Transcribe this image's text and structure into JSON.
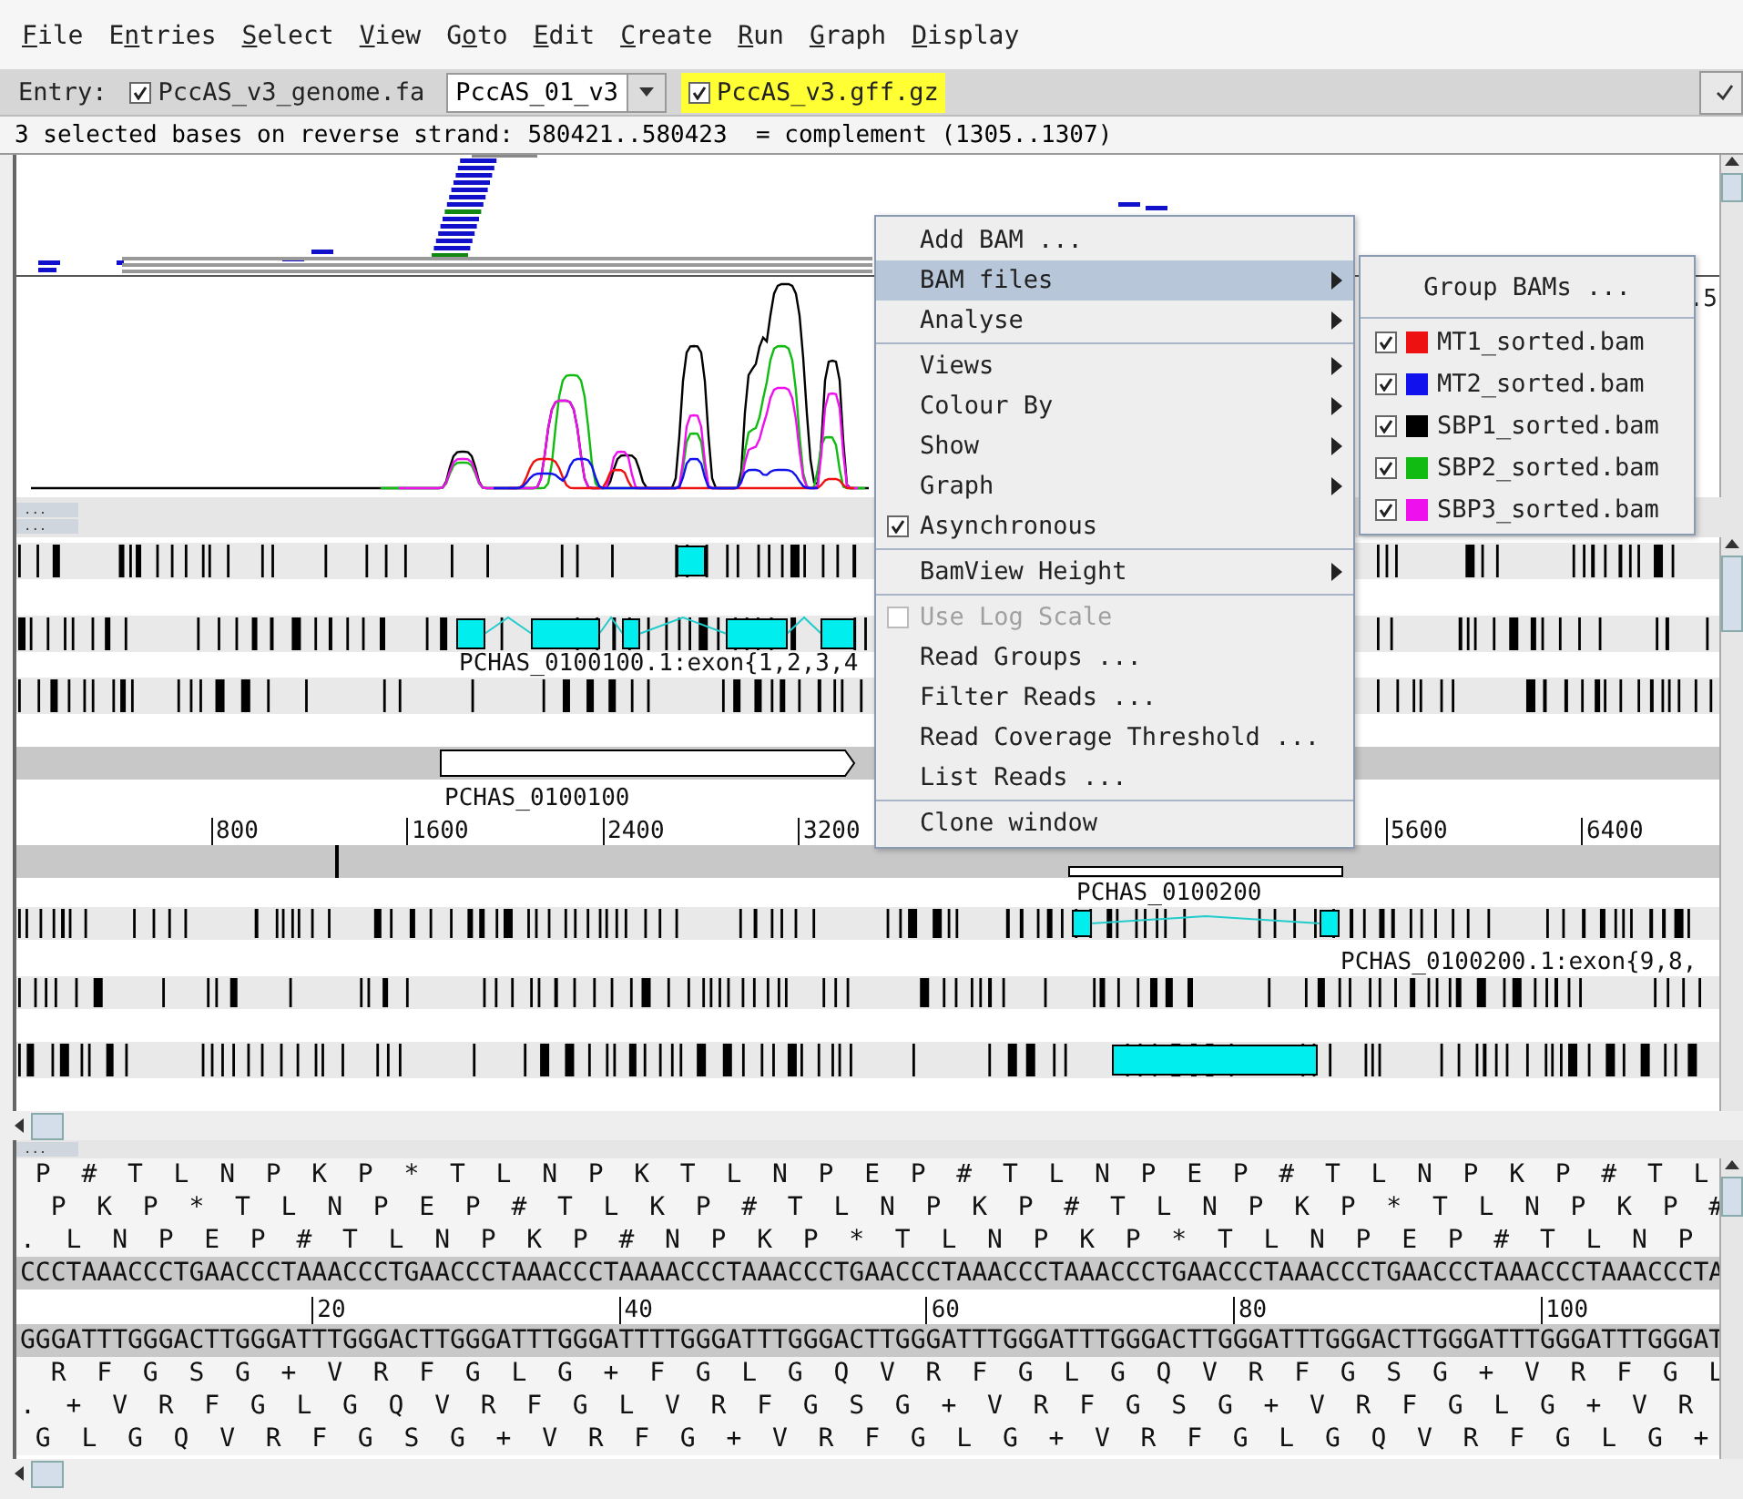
{
  "menu_bar": [
    {
      "underlined": "F",
      "after": "ile"
    },
    {
      "before": "E",
      "underlined": "n",
      "after": "tries"
    },
    {
      "underlined": "S",
      "after": "elect"
    },
    {
      "underlined": "V",
      "after": "iew"
    },
    {
      "before": "G",
      "underlined": "o",
      "after": "to"
    },
    {
      "underlined": "E",
      "after": "dit"
    },
    {
      "underlined": "C",
      "after": "reate"
    },
    {
      "underlined": "R",
      "after": "un"
    },
    {
      "underlined": "G",
      "after": "raph"
    },
    {
      "underlined": "D",
      "after": "isplay"
    }
  ],
  "entry_bar": {
    "label": "Entry:",
    "entries": [
      {
        "name": "PccAS_v3_genome.fa",
        "checked": true,
        "highlighted": false,
        "kind": "sequence"
      },
      {
        "name": "PccAS_v3.gff.gz",
        "checked": true,
        "highlighted": true,
        "kind": "annotation"
      }
    ],
    "combo_value": "PccAS_01_v3"
  },
  "status_line": "3 selected bases on reverse strand: 580421..580423  = complement (1305..1307)",
  "bam_view": {
    "axis_label": ".5"
  },
  "pane_buttons": [
    "...",
    "..."
  ],
  "feature_view": {
    "forward_exon_label": "PCHAS_0100100.1:exon{1,2,3,4",
    "forward_gene_label": "PCHAS_0100100",
    "ruler": [
      "800",
      "1600",
      "2400",
      "3200",
      "5600",
      "6400"
    ],
    "reverse_gene_label": "PCHAS_0100200",
    "reverse_exon_label": "PCHAS_0100200.1:exon{9,8,"
  },
  "sequence_button": "...",
  "sequence_view": {
    "forward_frames": [
      " P  #  T  L  N  P  K  P  *  T  L  N  P  K  T  L  N  P  E  P  #  T  L  N  P  E  P  #  T  L  N  P  K  P  #  T  L",
      "  P  K  P  *  T  L  N  P  E  P  #  T  L  K  P  #  T  L  N  P  K  P  #  T  L  N  P  K  P  *  T  L  N  P  K  P  #",
      ".  L  N  P  E  P  #  T  L  N  P  K  P  #  N  P  K  P  *  T  L  N  P  K  P  *  T  L  N  P  E  P  #  T  L  N  P"
    ],
    "forward_strand": "CCCTAAACCCTGAACCCTAAACCCTGAACCCTAAACCCTAAAACCCTAAACCCTGAACCCTAAACCCTAAACCCTGAACCCTAAACCCTGAACCCTAAACCCTAAACCCTA",
    "ruler": [
      "20",
      "40",
      "60",
      "80",
      "100"
    ],
    "reverse_strand": "GGGATTTGGGACTTGGGATTTGGGACTTGGGATTTGGGATTTTGGGATTTGGGACTTGGGATTTGGGATTTGGGACTTGGGATTTGGGACTTGGGATTTGGGATTTGGGAT",
    "reverse_frames": [
      "  R  F  G  S  G  +  V  R  F  G  L  G  +  F  G  L  G  Q  V  R  F  G  L  G  Q  V  R  F  G  S  G  +  V  R  F  G  L",
      ".  +  V  R  F  G  L  G  Q  V  R  F  G  L  V  R  F  G  S  G  +  V  R  F  G  S  G  +  V  R  F  G  L  G  +  V  R",
      " G  L  G  Q  V  R  F  G  S  G  +  V  R  F  G  +  V  R  F  G  L  G  +  V  R  F  G  L  G  Q  V  R  F  G  L  G  +"
    ]
  },
  "bam_menu": {
    "groups": [
      [
        {
          "label": "Add BAM ...",
          "kind": "action",
          "selected": false,
          "disabled": false
        },
        {
          "label": "BAM files",
          "kind": "submenu",
          "selected": true,
          "disabled": false
        },
        {
          "label": "Analyse",
          "kind": "submenu",
          "selected": false,
          "disabled": false
        }
      ],
      [
        {
          "label": "Views",
          "kind": "submenu",
          "selected": false,
          "disabled": false
        },
        {
          "label": "Colour By",
          "kind": "submenu",
          "selected": false,
          "disabled": false
        },
        {
          "label": "Show",
          "kind": "submenu",
          "selected": false,
          "disabled": false
        },
        {
          "label": "Graph",
          "kind": "submenu",
          "selected": false,
          "disabled": false
        },
        {
          "label": "Asynchronous",
          "kind": "checkbox",
          "checked": true,
          "selected": false,
          "disabled": false
        }
      ],
      [
        {
          "label": "BamView Height",
          "kind": "submenu",
          "selected": false,
          "disabled": false
        }
      ],
      [
        {
          "label": "Use Log Scale",
          "kind": "checkbox",
          "checked": false,
          "selected": false,
          "disabled": true
        },
        {
          "label": "Read Groups ...",
          "kind": "action",
          "selected": false,
          "disabled": false
        },
        {
          "label": "Filter Reads ...",
          "kind": "action",
          "selected": false,
          "disabled": false
        },
        {
          "label": "Read Coverage Threshold ...",
          "kind": "action",
          "selected": false,
          "disabled": false
        },
        {
          "label": "List Reads ...",
          "kind": "action",
          "selected": false,
          "disabled": false
        }
      ],
      [
        {
          "label": "Clone window",
          "kind": "action",
          "selected": false,
          "disabled": false
        }
      ]
    ]
  },
  "bam_files_menu": {
    "header": "Group BAMs ...",
    "files": [
      {
        "name": "MT1_sorted.bam",
        "checked": true,
        "color": "#ee1111"
      },
      {
        "name": "MT2_sorted.bam",
        "checked": true,
        "color": "#1111ee"
      },
      {
        "name": "SBP1_sorted.bam",
        "checked": true,
        "color": "#000000"
      },
      {
        "name": "SBP2_sorted.bam",
        "checked": true,
        "color": "#11bb11"
      },
      {
        "name": "SBP3_sorted.bam",
        "checked": true,
        "color": "#ee11ee"
      }
    ]
  }
}
